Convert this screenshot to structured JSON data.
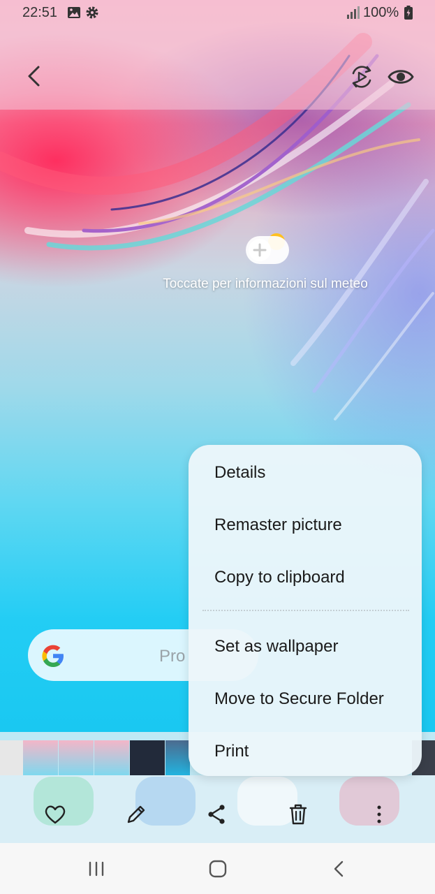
{
  "status_bar": {
    "time": "22:51",
    "battery": "100%",
    "icons": [
      "image-icon",
      "gear-icon",
      "signal-icon",
      "battery-icon"
    ]
  },
  "viewer_toolbar": {
    "icons": [
      "back-icon",
      "motion-play-icon",
      "eye-icon"
    ]
  },
  "photo": {
    "weather_text": "Toccate per informazioni sul meteo",
    "search_placeholder": "Pro"
  },
  "context_menu": {
    "items": [
      {
        "label": "Details"
      },
      {
        "label": "Remaster picture"
      },
      {
        "label": "Copy to clipboard"
      },
      {
        "label": "Set as wallpaper"
      },
      {
        "label": "Move to Secure Folder"
      },
      {
        "label": "Print"
      }
    ]
  },
  "action_bar": {
    "icons": [
      "favorite-heart-icon",
      "edit-pencil-icon",
      "share-icon",
      "delete-trash-icon",
      "more-options-icon"
    ]
  },
  "nav_bar": {
    "icons": [
      "recents-icon",
      "home-icon",
      "back-icon"
    ]
  },
  "colors": {
    "menu_bg": "#ecf6fa",
    "bottom_bar_bg": "#d9eef6",
    "nav_bar_bg": "#f7f7f7"
  }
}
